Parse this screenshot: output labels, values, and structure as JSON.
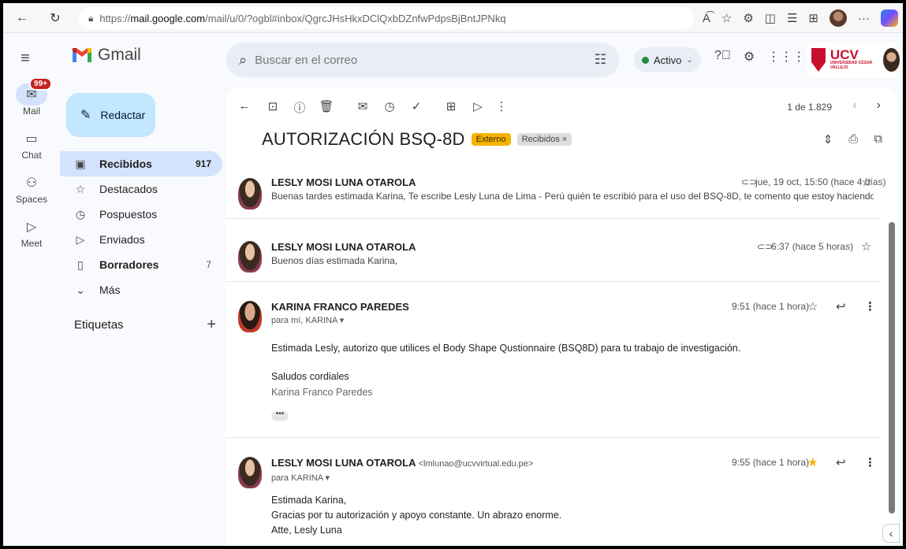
{
  "browser": {
    "url_prefix": "https://",
    "url_host": "mail.google.com",
    "url_path": "/mail/u/0/?ogbl#inbox/QgrcJHsHkxDClQxbDZnfwPdpsBjBntJPNkq"
  },
  "header": {
    "app_name": "Gmail",
    "search_placeholder": "Buscar en el correo",
    "status_label": "Activo",
    "org_logo_text": "UCV",
    "org_logo_sub": "UNIVERSIDAD CÉSAR VALLEJO"
  },
  "rail": {
    "mail_label": "Mail",
    "mail_badge": "99+",
    "chat_label": "Chat",
    "spaces_label": "Spaces",
    "meet_label": "Meet"
  },
  "nav": {
    "compose_label": "Redactar",
    "items": [
      {
        "label": "Recibidos",
        "count": "917"
      },
      {
        "label": "Destacados",
        "count": ""
      },
      {
        "label": "Pospuestos",
        "count": ""
      },
      {
        "label": "Enviados",
        "count": ""
      },
      {
        "label": "Borradores",
        "count": "7"
      },
      {
        "label": "Más",
        "count": ""
      }
    ],
    "labels_heading": "Etiquetas"
  },
  "toolbar": {
    "pager_text": "1 de 1.829"
  },
  "thread": {
    "subject": "AUTORIZACIÓN BSQ-8D",
    "tag_external": "Externo",
    "tag_inbox": "Recibidos ×",
    "messages": [
      {
        "sender": "LESLY MOSI LUNA OTAROLA",
        "time": "jue, 19 oct, 15:50 (hace 4 días)",
        "snippet": "Buenas tardes estimada Karina, Te escribe Lesly Luna de Lima - Perú quién te escribió para el uso del BSQ-8D, te comento que estoy haciendo reajustes a ..."
      },
      {
        "sender": "LESLY MOSI LUNA OTAROLA",
        "time": "6:37 (hace 5 horas)",
        "snippet": "Buenos días estimada Karina,"
      },
      {
        "sender": "KARINA FRANCO PAREDES",
        "time": "9:51 (hace 1 hora)",
        "to": "para mí, KARINA ▾",
        "body_line1": "Estimada Lesly, autorizo que utilices el Body Shape Qustionnaire (BSQ8D) para tu trabajo de investigación.",
        "body_line2": "Saludos cordiales",
        "body_sig": "Karina Franco Paredes",
        "dots": "•••"
      },
      {
        "sender": "LESLY MOSI LUNA OTAROLA",
        "address": "<lmlunao@ucvvirtual.edu.pe>",
        "time": "9:55 (hace 1 hora)",
        "to": "para KARINA ▾",
        "body_line1": "Estimada Karina,",
        "body_line2": "Gracias por tu autorización y apoyo constante. Un abrazo enorme.",
        "body_line3": "Atte, Lesly Luna"
      }
    ]
  },
  "colors": {
    "compose_bg": "#c2e7ff",
    "active_nav_bg": "#d3e3fd",
    "external_tag": "#f5b400",
    "star_on": "#f4b400",
    "status_dot": "#1e8e3e"
  }
}
